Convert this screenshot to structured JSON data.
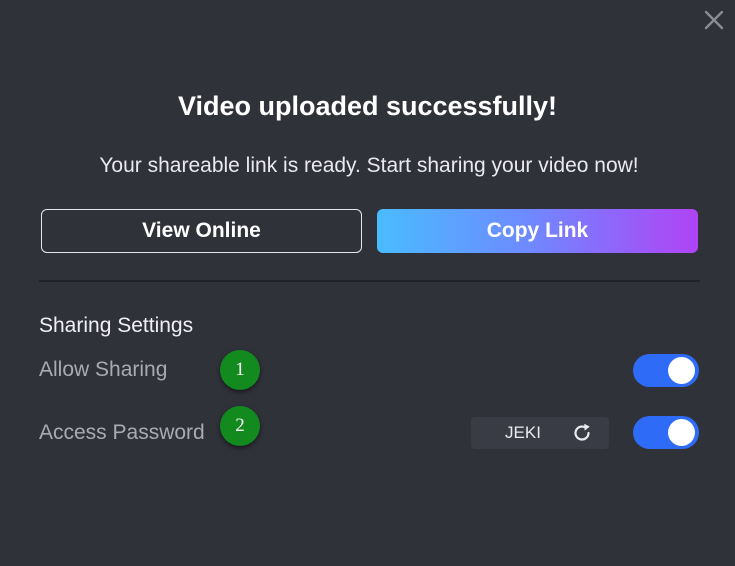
{
  "dialog": {
    "close_icon": "close-icon",
    "title": "Video uploaded successfully!",
    "subtitle": "Your shareable link is ready. Start sharing your video now!",
    "buttons": {
      "view_online": "View Online",
      "copy_link": "Copy Link"
    }
  },
  "sharing": {
    "title": "Sharing Settings",
    "allow_sharing": {
      "label": "Allow Sharing",
      "enabled": true
    },
    "access_password": {
      "label": "Access Password",
      "value": "JEKI",
      "refresh_icon": "refresh-icon",
      "enabled": true
    }
  },
  "markers": [
    "1",
    "2"
  ],
  "colors": {
    "background": "#30323a",
    "toggle_on": "#2e6bf6",
    "gradient_start": "#49bcff",
    "gradient_end": "#b043f5",
    "marker": "#128a1e"
  }
}
